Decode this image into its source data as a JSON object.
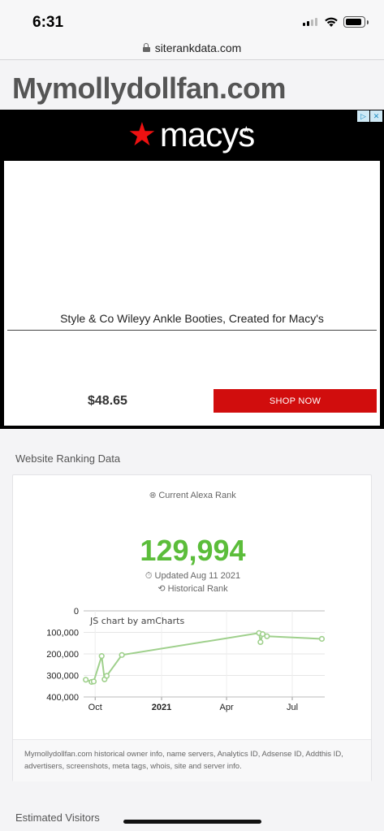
{
  "status_bar": {
    "time": "6:31"
  },
  "browser": {
    "url": "siterankdata.com"
  },
  "page": {
    "title": "Mymollydollfan.com"
  },
  "ad": {
    "brand": "macys",
    "product_name": "Style & Co Wileyy Ankle Booties, Created for Macy's",
    "price": "$48.65",
    "cta": "SHOP NOW",
    "choices_icons": [
      "adchoices-icon",
      "close-icon"
    ]
  },
  "ranking": {
    "section_title": "Website Ranking Data",
    "alexa_label": "Current Alexa Rank",
    "rank": "129,994",
    "updated": "Updated Aug 11 2021",
    "historical_label": "Historical Rank",
    "footer_text": "Mymollydollfan.com historical owner info, name servers, Analytics ID, Adsense ID, Addthis ID, advertisers, screenshots, meta tags, whois, site and server info."
  },
  "visitors": {
    "section_title": "Estimated Visitors"
  },
  "colors": {
    "rank_green": "#5bbd3a",
    "ad_red": "#d10d0d",
    "line_green": "#9fd08c"
  },
  "chart_data": {
    "type": "line",
    "watermark": "JS chart by amCharts",
    "y_reversed": true,
    "ylim": [
      0,
      400000
    ],
    "y_ticks": [
      0,
      100000,
      200000,
      300000,
      400000
    ],
    "y_tick_labels": [
      "0",
      "100,000",
      "200,000",
      "300,000",
      "400,000"
    ],
    "x_tick_labels": [
      "Oct",
      "2021",
      "Apr",
      "Jul"
    ],
    "x_tick_dates": [
      "2020-10-01",
      "2021-01-01",
      "2021-04-01",
      "2021-07-01"
    ],
    "xlim": [
      "2020-09-15",
      "2021-08-15"
    ],
    "grid": true,
    "series": [
      {
        "x": [
          "2020-09-18",
          "2020-09-26",
          "2020-09-29",
          "2020-10-10",
          "2020-10-14",
          "2020-10-17",
          "2020-11-07",
          "2021-05-16",
          "2021-05-18",
          "2021-05-21",
          "2021-05-27",
          "2021-08-11"
        ],
        "y": [
          320000,
          330000,
          328000,
          210000,
          318000,
          302000,
          205000,
          103000,
          145000,
          108000,
          118000,
          129994
        ]
      }
    ]
  }
}
